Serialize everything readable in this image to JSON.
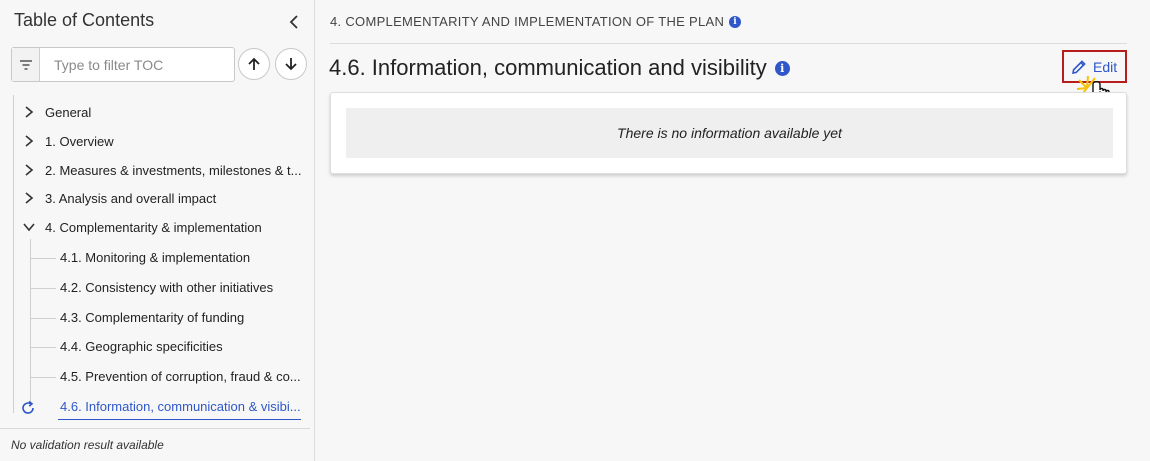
{
  "sidebar": {
    "title": "Table of Contents",
    "filter": {
      "placeholder": "Type to filter TOC"
    },
    "items": [
      {
        "label": "General",
        "expanded": false
      },
      {
        "label": "1. Overview",
        "expanded": false
      },
      {
        "label": "2. Measures & investments, milestones & t...",
        "expanded": false
      },
      {
        "label": "3. Analysis and overall impact",
        "expanded": false
      },
      {
        "label": "4. Complementarity & implementation",
        "expanded": true
      }
    ],
    "subitems": [
      {
        "label": "4.1. Monitoring & implementation"
      },
      {
        "label": "4.2. Consistency with other initiatives"
      },
      {
        "label": "4.3. Complementarity of funding"
      },
      {
        "label": "4.4. Geographic specificities"
      },
      {
        "label": "4.5. Prevention of corruption, fraud & co..."
      },
      {
        "label": "4.6. Information, communication & visibi...",
        "active": true
      }
    ],
    "footer": "No validation result available"
  },
  "main": {
    "breadcrumb": "4. COMPLEMENTARITY AND IMPLEMENTATION OF THE PLAN",
    "title": "4.6. Information, communication and visibility",
    "edit_label": "Edit",
    "empty_message": "There is no information available yet"
  },
  "colors": {
    "accent": "#2f57c9",
    "highlight_border": "#b81d1d"
  }
}
